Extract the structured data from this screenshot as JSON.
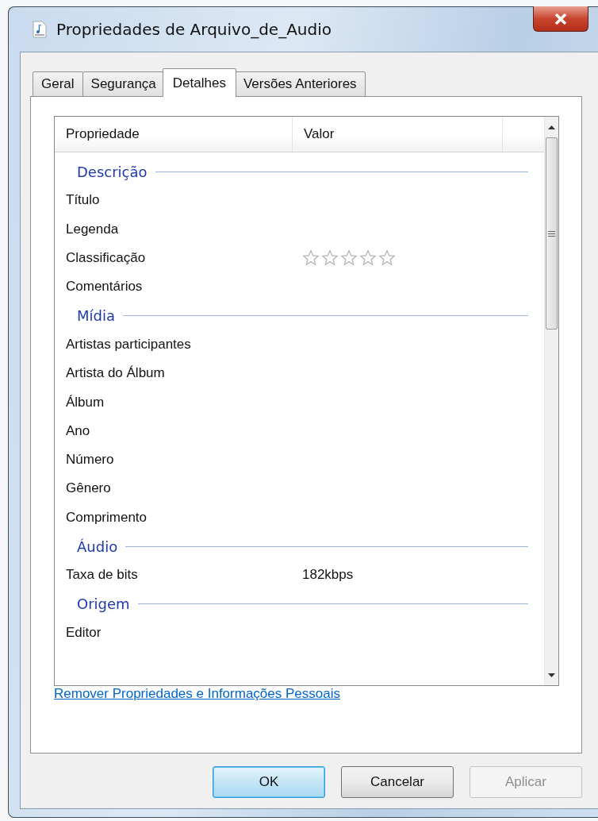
{
  "window": {
    "title": "Propriedades de Arquivo_de_Audio"
  },
  "tabs": [
    {
      "label": "Geral",
      "selected": false
    },
    {
      "label": "Segurança",
      "selected": false
    },
    {
      "label": "Detalhes",
      "selected": true
    },
    {
      "label": "Versões Anteriores",
      "selected": false
    }
  ],
  "table": {
    "columns": [
      "Propriedade",
      "Valor"
    ],
    "rows": [
      {
        "kind": "group",
        "label": "Descrição"
      },
      {
        "kind": "text",
        "label": "Título"
      },
      {
        "kind": "text",
        "label": "Legenda"
      },
      {
        "kind": "rating",
        "label": "Classificação",
        "stars": 0
      },
      {
        "kind": "text",
        "label": "Comentários"
      },
      {
        "kind": "group",
        "label": "Mídia"
      },
      {
        "kind": "text",
        "label": "Artistas participantes"
      },
      {
        "kind": "text",
        "label": "Artista do Álbum"
      },
      {
        "kind": "text",
        "label": "Álbum"
      },
      {
        "kind": "text",
        "label": "Ano"
      },
      {
        "kind": "text",
        "label": "Número"
      },
      {
        "kind": "text",
        "label": "Gênero"
      },
      {
        "kind": "text",
        "label": "Comprimento"
      },
      {
        "kind": "group",
        "label": "Áudio"
      },
      {
        "kind": "text",
        "label": "Taxa de bits",
        "value": "182kbps"
      },
      {
        "kind": "group",
        "label": "Origem"
      },
      {
        "kind": "text",
        "label": "Editor"
      }
    ]
  },
  "link": "Remover Propriedades e Informações Pessoais",
  "buttons": [
    {
      "label": "OK",
      "default": true,
      "disabled": false
    },
    {
      "label": "Cancelar",
      "default": false,
      "disabled": false
    },
    {
      "label": "Aplicar",
      "default": false,
      "disabled": true
    }
  ]
}
